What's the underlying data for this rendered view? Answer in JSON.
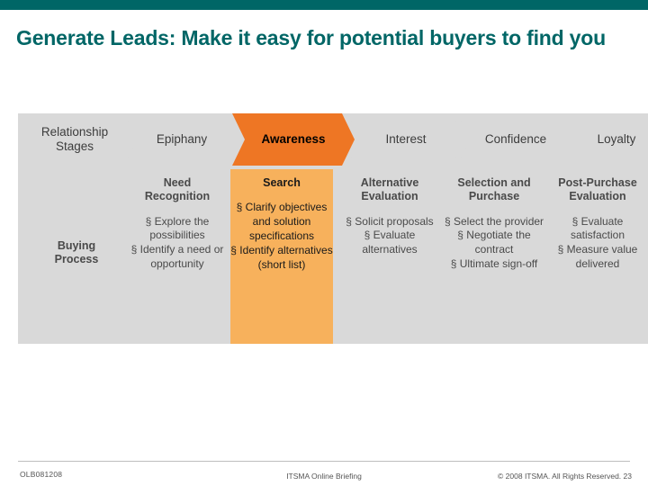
{
  "slide": {
    "title": "Generate Leads: Make it easy for potential buyers to find you",
    "accent_color": "#006666",
    "highlight_color": "#f7b15c",
    "panel_color": "#d9d9d9"
  },
  "row_labels": {
    "relationship_stages": "Relationship\nStages",
    "buying_process": "Buying\nProcess"
  },
  "stages": [
    {
      "chevron": "Epiphany",
      "sub_head": "Need\nRecognition",
      "bullets": [
        "§ Explore the possibilities",
        "§ Identify a need or opportunity"
      ],
      "highlight": false
    },
    {
      "chevron": "Awareness",
      "sub_head": "Search",
      "bullets": [
        "§ Clarify objectives and solution specifications",
        "§ Identify alternatives (short list)"
      ],
      "highlight": true
    },
    {
      "chevron": "Interest",
      "sub_head": "Alternative\nEvaluation",
      "bullets": [
        "§ Solicit proposals",
        "§ Evaluate alternatives"
      ],
      "highlight": false
    },
    {
      "chevron": "Confidence",
      "sub_head": "Selection and\nPurchase",
      "bullets": [
        "§ Select the provider",
        "§ Negotiate the contract",
        "§ Ultimate sign-off"
      ],
      "highlight": false
    },
    {
      "chevron": "Loyalty",
      "sub_head": "Post-Purchase\nEvaluation",
      "bullets": [
        "§ Evaluate satisfaction",
        "§ Measure value delivered"
      ],
      "highlight": false
    }
  ],
  "footer": {
    "left": "OLB081208",
    "center": "ITSMA Online Briefing",
    "right": "© 2008 ITSMA. All Rights Reserved. 23"
  }
}
